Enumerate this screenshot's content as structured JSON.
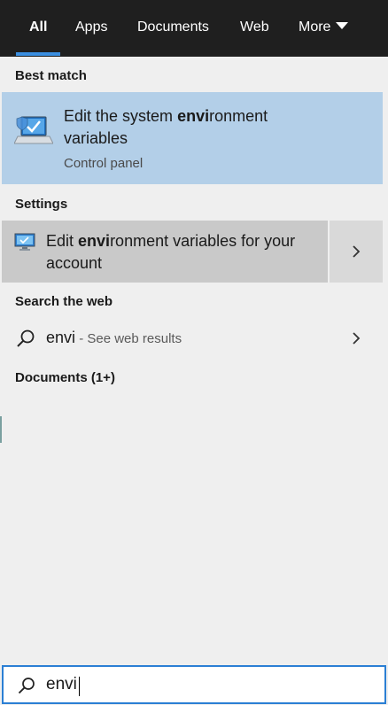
{
  "tabs": [
    {
      "label": "All",
      "active": true
    },
    {
      "label": "Apps",
      "active": false
    },
    {
      "label": "Documents",
      "active": false
    },
    {
      "label": "Web",
      "active": false
    },
    {
      "label": "More",
      "active": false
    }
  ],
  "sections": {
    "best_match": "Best match",
    "settings": "Settings",
    "search_web": "Search the web",
    "documents": "Documents (1+)"
  },
  "best_match": {
    "title_pre": "Edit the system ",
    "title_match": "envi",
    "title_post": "ronment variables",
    "subtitle": "Control panel",
    "icon": "system-computer-icon"
  },
  "setting": {
    "title_pre": "Edit ",
    "title_match": "envi",
    "title_post": "ronment variables for your account",
    "icon": "monitor-settings-icon"
  },
  "web": {
    "query": "envi",
    "suffix": " - See web results",
    "icon": "search-icon"
  },
  "search": {
    "value": "envi",
    "icon": "search-icon"
  },
  "colors": {
    "tabbar_bg": "#1f1f1f",
    "accent": "#3b8fe0",
    "best_match_bg": "#b3cfe8",
    "setting_hover_bg": "#c9c9c9",
    "panel_bg": "#efefef"
  }
}
